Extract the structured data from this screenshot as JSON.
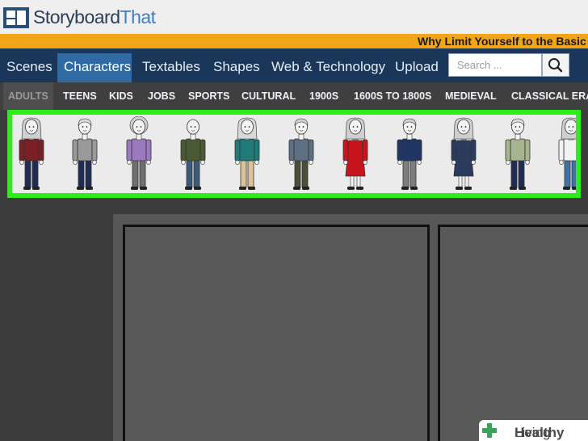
{
  "logo": {
    "part1": "Storyboard",
    "part2": "That"
  },
  "banner": {
    "text": "Why Limit Yourself to the Basic"
  },
  "nav": {
    "tabs": [
      {
        "label": "Scenes"
      },
      {
        "label": "Characters",
        "active": true
      },
      {
        "label": "Textables"
      },
      {
        "label": "Shapes"
      },
      {
        "label": "Web & Technology"
      },
      {
        "label": "Upload"
      }
    ]
  },
  "search": {
    "placeholder": "Search ..."
  },
  "categories": [
    {
      "label": "ADULTS",
      "active": true
    },
    {
      "label": "TEENS"
    },
    {
      "label": "KIDS"
    },
    {
      "label": "JOBS"
    },
    {
      "label": "SPORTS"
    },
    {
      "label": "CULTURAL"
    },
    {
      "label": "1900S"
    },
    {
      "label": "1600S TO 1800S"
    },
    {
      "label": "MEDIEVAL"
    },
    {
      "label": "CLASSICAL ERA"
    }
  ],
  "characters": [
    {
      "name": "woman-red-cardigan",
      "shirt": "#7a1f24",
      "pants": "#1f2d55",
      "hair": "#cfcfcf",
      "hairStyle": "long"
    },
    {
      "name": "man-gray-shirt",
      "shirt": "#9a9a9a",
      "pants": "#1f2d55",
      "hair": "#d8d8d8",
      "hairStyle": "short"
    },
    {
      "name": "woman-purple-top",
      "shirt": "#9b7ac2",
      "pants": "#6f6f6f",
      "hair": "#d0d0d0",
      "hairStyle": "curly"
    },
    {
      "name": "bald-man-green-jacket",
      "shirt": "#4a5a35",
      "pants": "#3e5a7a",
      "hair": "#d8c0a8",
      "hairStyle": "bald"
    },
    {
      "name": "woman-teal-top",
      "shirt": "#1f7a7a",
      "pants": "#d9c49a",
      "hair": "#d8d8d8",
      "hairStyle": "long"
    },
    {
      "name": "man-slate-shirt",
      "shirt": "#5d6f82",
      "pants": "#4a4f38",
      "hair": "#cfcfcf",
      "hairStyle": "short"
    },
    {
      "name": "woman-red-dress",
      "shirt": "#c8141c",
      "pants": "#c8141c",
      "hair": "#cfcfcf",
      "hairStyle": "long",
      "dress": true
    },
    {
      "name": "man-navy-sweater",
      "shirt": "#1f3566",
      "pants": "#7d7d7d",
      "hair": "#d0d0d0",
      "hairStyle": "short"
    },
    {
      "name": "woman-navy-dress",
      "shirt": "#2b3b5e",
      "pants": "#2b3b5e",
      "hair": "#cfcfcf",
      "hairStyle": "long",
      "dress": true
    },
    {
      "name": "man-plaid-shirt",
      "shirt": "#a7b58f",
      "pants": "#1f2d55",
      "hair": "#d8d8d8",
      "hairStyle": "short"
    },
    {
      "name": "man-white-shirt",
      "shirt": "#f2f2f2",
      "pants": "#3f72a8",
      "hair": "#cfcfcf",
      "hairStyle": "long"
    }
  ],
  "watermark": {
    "part1": "Healthy",
    "part2": "Living"
  },
  "colors": {
    "highlight": "#2aef19",
    "navBg": "#1a3658",
    "navActive": "#2f6aa3",
    "banner": "#f2a516"
  }
}
